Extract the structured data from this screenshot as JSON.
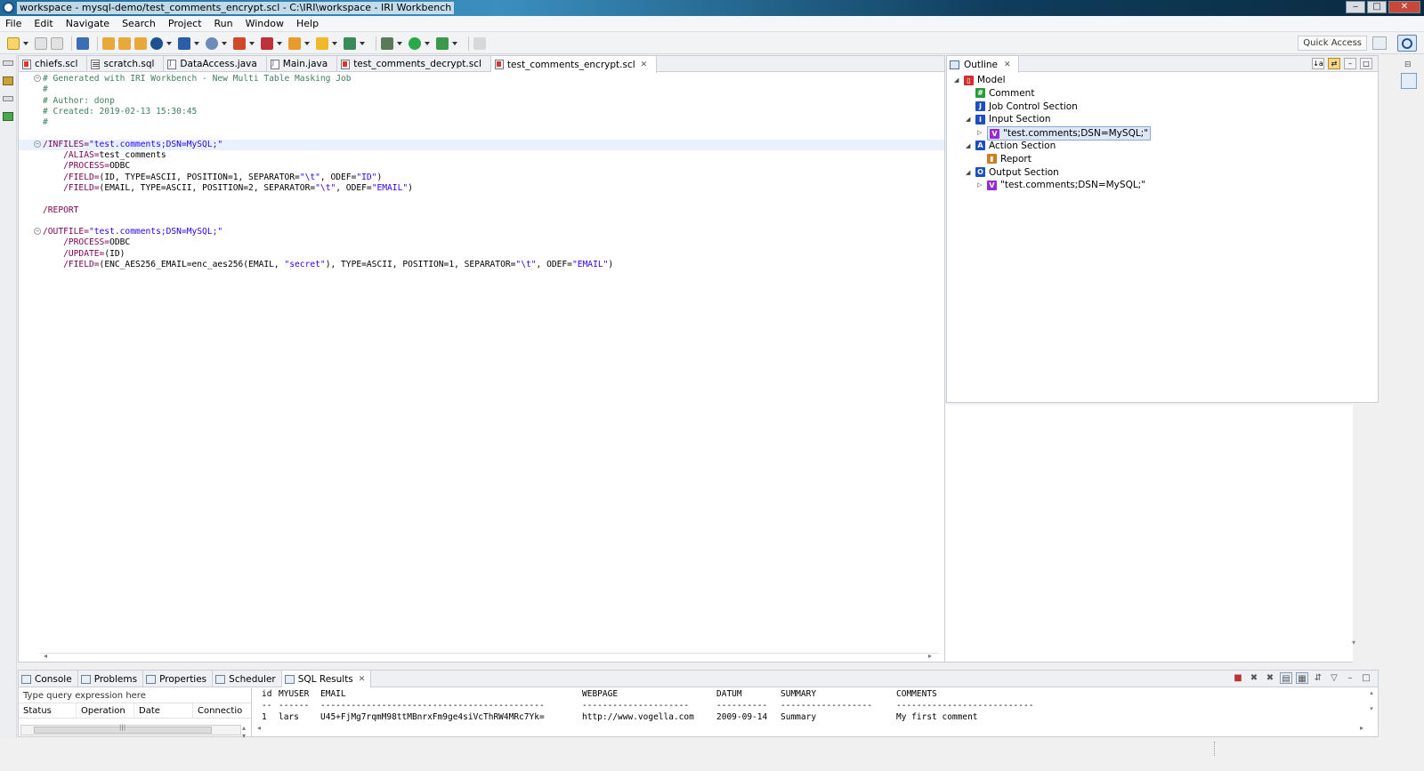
{
  "window": {
    "title": "workspace - mysql-demo/test_comments_encrypt.scl - C:\\IRI\\workspace - IRI Workbench",
    "controls": {
      "minimize": "‒",
      "maximize": "□",
      "close": "✕"
    }
  },
  "menu": [
    "File",
    "Edit",
    "Navigate",
    "Search",
    "Project",
    "Run",
    "Window",
    "Help"
  ],
  "toolbar": {
    "quick_access": "Quick Access"
  },
  "editor": {
    "tabs": [
      {
        "label": "chiefs.scl",
        "type": "scl"
      },
      {
        "label": "scratch.sql",
        "type": "sql"
      },
      {
        "label": "DataAccess.java",
        "type": "java"
      },
      {
        "label": "Main.java",
        "type": "java"
      },
      {
        "label": "test_comments_decrypt.scl",
        "type": "scl"
      },
      {
        "label": "test_comments_encrypt.scl",
        "type": "scl",
        "active": true
      }
    ],
    "lines": [
      {
        "fold": "⊖",
        "segs": [
          [
            "c-com",
            "# Generated with IRI Workbench - New Multi Table Masking Job"
          ]
        ]
      },
      {
        "segs": [
          [
            "c-com",
            "#"
          ]
        ]
      },
      {
        "segs": [
          [
            "c-com",
            "# Author: donp"
          ]
        ]
      },
      {
        "segs": [
          [
            "c-com",
            "# Created: 2019-02-13 15:30:45"
          ]
        ]
      },
      {
        "segs": [
          [
            "c-com",
            "#"
          ]
        ]
      },
      {
        "segs": []
      },
      {
        "fold": "⊖",
        "cur": true,
        "segs": [
          [
            "c-kw",
            "/INFILES="
          ],
          [
            "c-str",
            "\"test.comments;DSN=MySQL;\""
          ]
        ]
      },
      {
        "segs": [
          [
            "c-kw",
            "    /ALIAS="
          ],
          [
            "c-pl",
            "test_comments"
          ]
        ]
      },
      {
        "segs": [
          [
            "c-kw",
            "    /PROCESS="
          ],
          [
            "c-pl",
            "ODBC"
          ]
        ]
      },
      {
        "segs": [
          [
            "c-kw",
            "    /FIELD="
          ],
          [
            "c-pl",
            "(ID, TYPE=ASCII, POSITION=1, SEPARATOR="
          ],
          [
            "c-str",
            "\"\\t\""
          ],
          [
            "c-pl",
            ", ODEF="
          ],
          [
            "c-str",
            "\"ID\""
          ],
          [
            "c-pl",
            ")"
          ]
        ]
      },
      {
        "segs": [
          [
            "c-kw",
            "    /FIELD="
          ],
          [
            "c-pl",
            "(EMAIL, TYPE=ASCII, POSITION=2, SEPARATOR="
          ],
          [
            "c-str",
            "\"\\t\""
          ],
          [
            "c-pl",
            ", ODEF="
          ],
          [
            "c-str",
            "\"EMAIL\""
          ],
          [
            "c-pl",
            ")"
          ]
        ]
      },
      {
        "segs": []
      },
      {
        "segs": [
          [
            "c-kw",
            "/REPORT"
          ]
        ]
      },
      {
        "segs": []
      },
      {
        "fold": "⊖",
        "segs": [
          [
            "c-kw",
            "/OUTFILE="
          ],
          [
            "c-str",
            "\"test.comments;DSN=MySQL;\""
          ]
        ]
      },
      {
        "segs": [
          [
            "c-kw",
            "    /PROCESS="
          ],
          [
            "c-pl",
            "ODBC"
          ]
        ]
      },
      {
        "segs": [
          [
            "c-kw",
            "    /UPDATE="
          ],
          [
            "c-pl",
            "(ID)"
          ]
        ]
      },
      {
        "segs": [
          [
            "c-kw",
            "    /FIELD="
          ],
          [
            "c-pl",
            "(ENC_AES256_EMAIL=enc_aes256(EMAIL, "
          ],
          [
            "c-str",
            "\"secret\""
          ],
          [
            "c-pl",
            "), TYPE=ASCII, POSITION=1, SEPARATOR="
          ],
          [
            "c-str",
            "\"\\t\""
          ],
          [
            "c-pl",
            ", ODEF="
          ],
          [
            "c-str",
            "\"EMAIL\""
          ],
          [
            "c-pl",
            ")"
          ]
        ]
      }
    ]
  },
  "outline": {
    "tab": "Outline",
    "tree": [
      {
        "label": "Model",
        "depth": 0,
        "twisty": "◢",
        "icon": "model-icon",
        "color": "#d03030",
        "glyph": "▯"
      },
      {
        "label": "Comment",
        "depth": 1,
        "twisty": "",
        "icon": "hash-icon",
        "color": "#2a9a3a",
        "glyph": "#"
      },
      {
        "label": "Job Control Section",
        "depth": 1,
        "twisty": "",
        "icon": "job-control-icon",
        "color": "#1d4fc0",
        "glyph": "J"
      },
      {
        "label": "Input Section",
        "depth": 1,
        "twisty": "◢",
        "icon": "input-section-icon",
        "color": "#1d4fc0",
        "glyph": "I"
      },
      {
        "label": "\"test.comments;DSN=MySQL;\"",
        "depth": 2,
        "twisty": "▷",
        "icon": "field-icon",
        "color": "#9a2ad0",
        "glyph": "V",
        "selected": true
      },
      {
        "label": "Action Section",
        "depth": 1,
        "twisty": "◢",
        "icon": "action-section-icon",
        "color": "#1d4fc0",
        "glyph": "A"
      },
      {
        "label": "Report",
        "depth": 2,
        "twisty": "",
        "icon": "report-icon",
        "color": "#d07a20",
        "glyph": "▮"
      },
      {
        "label": "Output Section",
        "depth": 1,
        "twisty": "◢",
        "icon": "output-section-icon",
        "color": "#1d4fc0",
        "glyph": "O"
      },
      {
        "label": "\"test.comments;DSN=MySQL;\"",
        "depth": 2,
        "twisty": "▷",
        "icon": "field-icon",
        "color": "#9a2ad0",
        "glyph": "V"
      }
    ]
  },
  "bottom": {
    "tabs": [
      {
        "label": "Console",
        "icon": "console-icon"
      },
      {
        "label": "Problems",
        "icon": "problems-icon"
      },
      {
        "label": "Properties",
        "icon": "properties-icon"
      },
      {
        "label": "Scheduler",
        "icon": "scheduler-icon"
      },
      {
        "label": "SQL Results",
        "icon": "sql-results-icon",
        "active": true
      }
    ],
    "query_placeholder": "Type query expression here",
    "history_columns": [
      "Status",
      "Operation",
      "Date",
      "Connectio"
    ],
    "results": {
      "columns": [
        "id",
        "MYUSER",
        "EMAIL",
        "WEBPAGE",
        "DATUM",
        "SUMMARY",
        "COMMENTS"
      ],
      "separator": [
        "--",
        "------",
        "--------------------------------------------",
        "---------------------",
        "----------",
        "------------------",
        "---------------------------"
      ],
      "rows": [
        [
          "1",
          "lars",
          "U45+FjMg7rqmM98ttMBnrxFm9ge4siVcThRW4MRc7Yk=",
          "http://www.vogella.com",
          "2009-09-14",
          "Summary",
          "My first comment"
        ]
      ]
    }
  }
}
